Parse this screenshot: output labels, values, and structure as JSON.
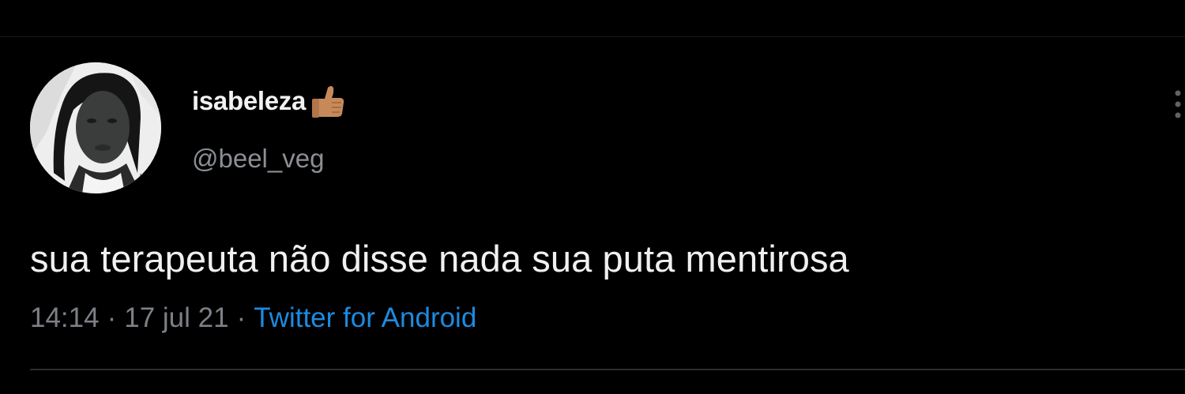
{
  "tweet": {
    "display_name": "isabeleza",
    "handle": "@beel_veg",
    "text": "sua terapeuta não disse nada sua puta mentirosa",
    "time": "14:14",
    "date": "17 jul 21",
    "separator": "·",
    "source": "Twitter for Android",
    "emoji_icon": "thumbs-up-medium-skin-tone",
    "more_icon": "vertical-ellipsis"
  },
  "colors": {
    "background": "#000000",
    "name": "#f2f2f2",
    "muted": "#7c8086",
    "link": "#1d8ae0"
  }
}
